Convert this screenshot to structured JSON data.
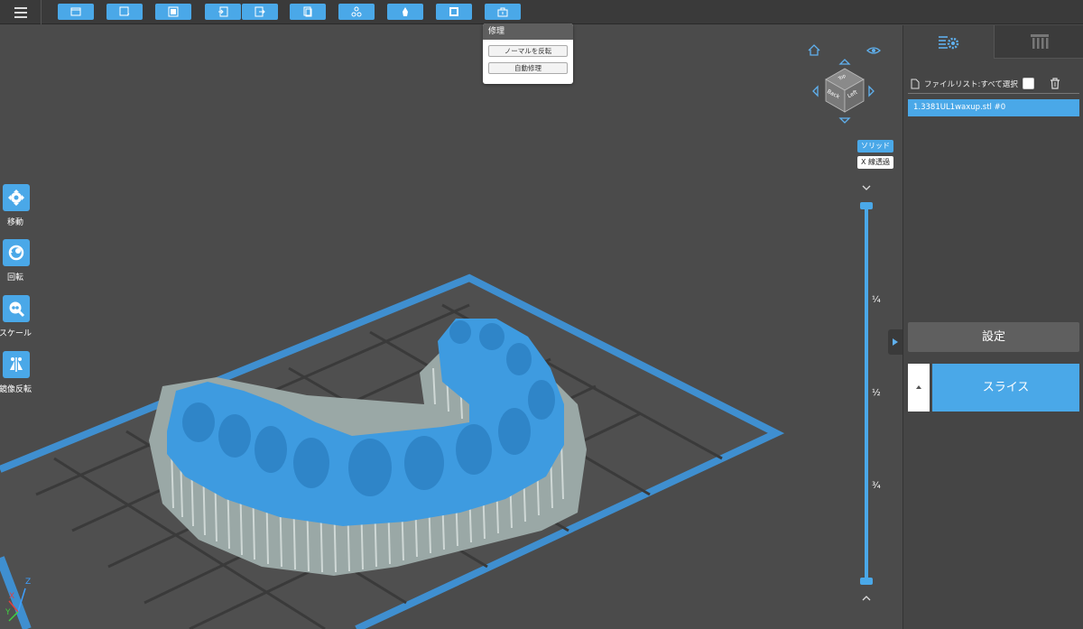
{
  "repair_menu": {
    "title": "修理",
    "flip_normals": "ノーマルを反転",
    "auto_repair": "自動修理"
  },
  "tools": [
    {
      "label": "移動",
      "icon": "move-icon"
    },
    {
      "label": "回転",
      "icon": "rotate-icon"
    },
    {
      "label": "スケール",
      "icon": "scale-icon"
    },
    {
      "label": "鏡像反転",
      "icon": "mirror-icon"
    }
  ],
  "view_cube": {
    "faces": [
      "Back",
      "Left",
      "Top"
    ]
  },
  "render_modes": {
    "solid": "ソリッド",
    "xray": "X 線透過"
  },
  "layer_slider": {
    "ticks": [
      "¼",
      "½",
      "¾"
    ]
  },
  "file_list": {
    "header": "ファイルリスト:すべて選択",
    "items": [
      "1.3381UL1waxup.stl #0"
    ]
  },
  "settings_button": "設定",
  "slice_button": "スライス",
  "axes": {
    "x": "X",
    "y": "Y",
    "z": "Z"
  },
  "colors": {
    "accent": "#4aa8e8",
    "model": "#3e9be0",
    "supports": "#c8d3d0"
  }
}
